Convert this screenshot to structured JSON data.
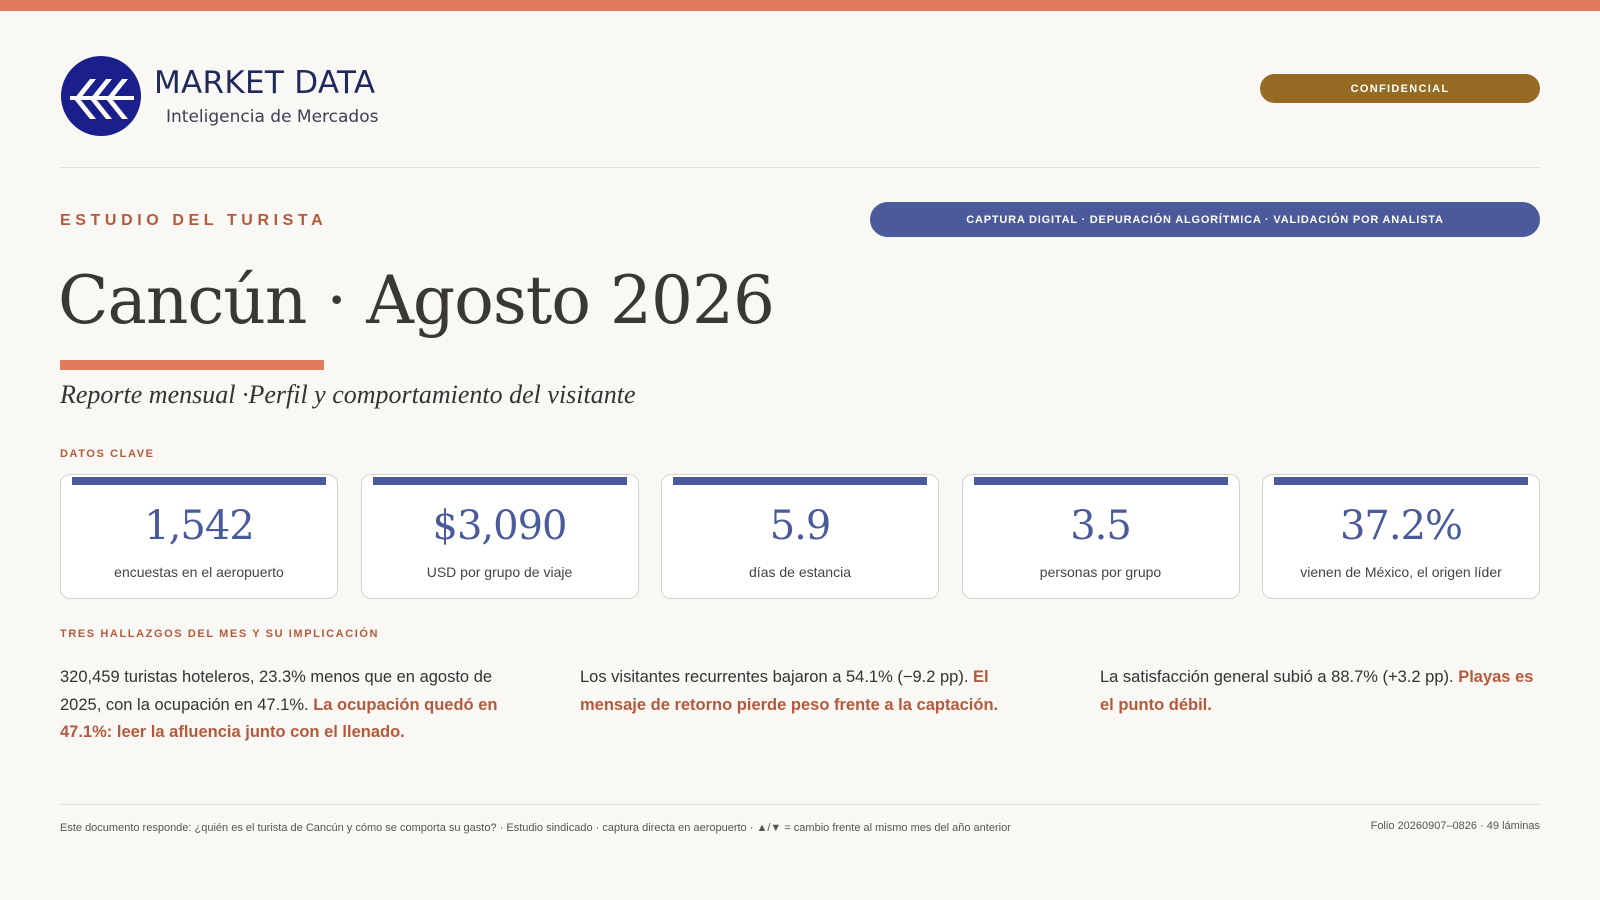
{
  "brand": {
    "name": "MARKET DATA",
    "tagline": "Inteligencia de Mercados",
    "logo_icon": "stripes-circle-logo",
    "color": "#1f2a5c"
  },
  "badges": {
    "confidential": "CONFIDENCIAL",
    "methodology": "CAPTURA DIGITAL · DEPURACIÓN ALGORÍTMICA · VALIDACIÓN POR ANALISTA"
  },
  "eyebrow": "ESTUDIO DEL TURISTA",
  "title": "Cancún · Agosto 2026",
  "subtitle": "Reporte mensual ·Perfil y comportamiento del visitante",
  "sections": {
    "key_data": "DATOS CLAVE",
    "findings": "TRES HALLAZGOS DEL MES Y SU IMPLICACIÓN"
  },
  "kpis": [
    {
      "value": "1,542",
      "label": "encuestas en el aeropuerto"
    },
    {
      "value": "$3,090",
      "label": "USD por grupo de viaje"
    },
    {
      "value": "5.9",
      "label": "días de estancia"
    },
    {
      "value": "3.5",
      "label": "personas por grupo"
    },
    {
      "value": "37.2%",
      "label": "vienen de México, el origen líder"
    }
  ],
  "findings": [
    {
      "text": "320,459 turistas hoteleros, 23.3% menos que en agosto de 2025, con la ocupación en 47.1%. ",
      "implication": "La ocupación quedó en 47.1%: leer la afluencia junto con el llenado."
    },
    {
      "text": "Los visitantes recurrentes bajaron a 54.1% (−9.2 pp). ",
      "implication": "El mensaje de retorno pierde peso frente a la captación."
    },
    {
      "text": "La satisfacción general subió a 88.7% (+3.2 pp). ",
      "implication": "Playas es el punto débil."
    }
  ],
  "footer": {
    "note": "Este documento responde: ¿quién es el turista de Cancún y cómo se comporta su gasto? · Estudio sindicado · captura directa en aeropuerto · ▲/▼ = cambio frente al mismo mes del año anterior",
    "folio": "Folio 20260907–0826 · 49 láminas"
  },
  "colors": {
    "accent": "#e07b5c",
    "accent_text": "#b45a3c",
    "primary": "#4a5a9a",
    "confidential": "#956a22"
  }
}
